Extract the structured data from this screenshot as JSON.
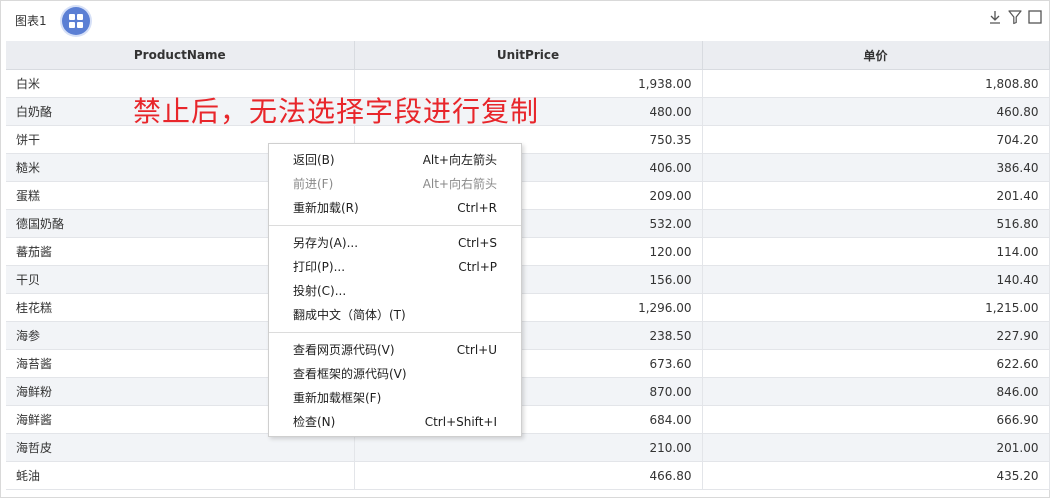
{
  "chart_title": "图表1",
  "annotation": "禁止后，无法选择字段进行复制",
  "columns": [
    "ProductName",
    "UnitPrice",
    "单价"
  ],
  "rows": [
    [
      "白米",
      "1,938.00",
      "1,808.80"
    ],
    [
      "白奶酪",
      "480.00",
      "460.80"
    ],
    [
      "饼干",
      "750.35",
      "704.20"
    ],
    [
      "糙米",
      "406.00",
      "386.40"
    ],
    [
      "蛋糕",
      "209.00",
      "201.40"
    ],
    [
      "德国奶酪",
      "532.00",
      "516.80"
    ],
    [
      "蕃茄酱",
      "120.00",
      "114.00"
    ],
    [
      "干贝",
      "156.00",
      "140.40"
    ],
    [
      "桂花糕",
      "1,296.00",
      "1,215.00"
    ],
    [
      "海参",
      "238.50",
      "227.90"
    ],
    [
      "海苔酱",
      "673.60",
      "622.60"
    ],
    [
      "海鲜粉",
      "870.00",
      "846.00"
    ],
    [
      "海鲜酱",
      "684.00",
      "666.90"
    ],
    [
      "海哲皮",
      "210.00",
      "201.00"
    ],
    [
      "蚝油",
      "466.80",
      "435.20"
    ]
  ],
  "context_menu": {
    "groups": [
      [
        {
          "label": "返回(B)",
          "shortcut": "Alt+向左箭头",
          "disabled": false
        },
        {
          "label": "前进(F)",
          "shortcut": "Alt+向右箭头",
          "disabled": true
        },
        {
          "label": "重新加载(R)",
          "shortcut": "Ctrl+R",
          "disabled": false
        }
      ],
      [
        {
          "label": "另存为(A)...",
          "shortcut": "Ctrl+S",
          "disabled": false
        },
        {
          "label": "打印(P)...",
          "shortcut": "Ctrl+P",
          "disabled": false
        },
        {
          "label": "投射(C)...",
          "shortcut": "",
          "disabled": false
        },
        {
          "label": "翻成中文（简体）(T)",
          "shortcut": "",
          "disabled": false
        }
      ],
      [
        {
          "label": "查看网页源代码(V)",
          "shortcut": "Ctrl+U",
          "disabled": false
        },
        {
          "label": "查看框架的源代码(V)",
          "shortcut": "",
          "disabled": false
        },
        {
          "label": "重新加载框架(F)",
          "shortcut": "",
          "disabled": false
        },
        {
          "label": "检查(N)",
          "shortcut": "Ctrl+Shift+I",
          "disabled": false
        }
      ]
    ]
  },
  "icons": {
    "layout": "grid-layout-icon",
    "download": "download-icon",
    "filter": "filter-icon",
    "maximize": "maximize-icon"
  },
  "colors": {
    "accent": "#5b7fd4",
    "header_bg": "#ebedf1",
    "alt_row_bg": "#f2f4f7",
    "annotation": "#e8262b"
  }
}
